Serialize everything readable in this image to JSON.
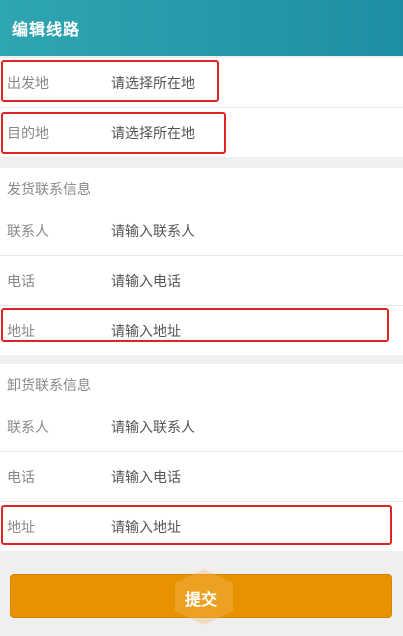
{
  "header": {
    "title": "编辑线路"
  },
  "route": {
    "origin": {
      "label": "出发地",
      "placeholder": "请选择所在地"
    },
    "destination": {
      "label": "目的地",
      "placeholder": "请选择所在地"
    }
  },
  "shipper": {
    "section_title": "发货联系信息",
    "contact": {
      "label": "联系人",
      "placeholder": "请输入联系人"
    },
    "phone": {
      "label": "电话",
      "placeholder": "请输入电话"
    },
    "address": {
      "label": "地址",
      "placeholder": "请输入地址"
    }
  },
  "consignee": {
    "section_title": "卸货联系信息",
    "contact": {
      "label": "联系人",
      "placeholder": "请输入联系人"
    },
    "phone": {
      "label": "电话",
      "placeholder": "请输入电话"
    },
    "address": {
      "label": "地址",
      "placeholder": "请输入地址"
    }
  },
  "submit": {
    "label": "提交"
  },
  "colors": {
    "header": "#2ea6b0",
    "accent": "#e89200",
    "highlight": "#e02424"
  }
}
